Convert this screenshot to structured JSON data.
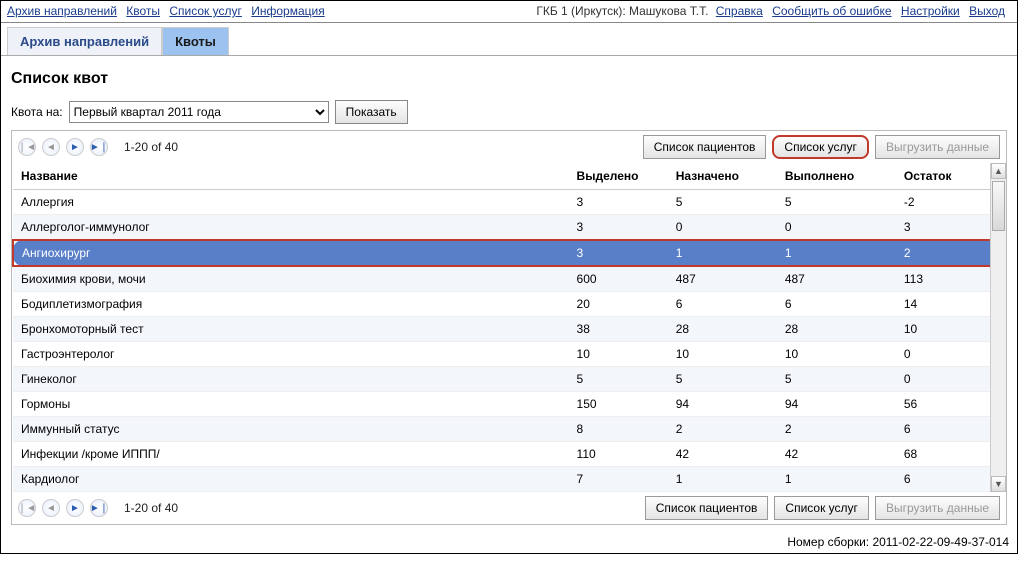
{
  "top_nav": {
    "left": [
      "Архив направлений",
      "Квоты",
      "Список услуг",
      "Информация"
    ],
    "right_user": "ГКБ 1 (Иркутск): Машукова Т.Т.",
    "right_links": [
      "Справка",
      "Сообщить об ошибке",
      "Настройки",
      "Выход"
    ]
  },
  "tabs": [
    {
      "label": "Архив направлений",
      "active": false
    },
    {
      "label": "Квоты",
      "active": true
    }
  ],
  "page_title": "Список квот",
  "filter": {
    "label": "Квота на:",
    "selected": "Первый квартал 2011 года",
    "show_btn": "Показать"
  },
  "pager": {
    "info": "1-20 of 40"
  },
  "action_buttons": {
    "patients": "Список пациентов",
    "services": "Список услуг",
    "export": "Выгрузить данные"
  },
  "columns": [
    "Название",
    "Выделено",
    "Назначено",
    "Выполнено",
    "Остаток"
  ],
  "rows": [
    {
      "name": "Аллергия",
      "allocated": "3",
      "assigned": "5",
      "done": "5",
      "rest": "-2"
    },
    {
      "name": "Аллерголог-иммунолог",
      "allocated": "3",
      "assigned": "0",
      "done": "0",
      "rest": "3"
    },
    {
      "name": "Ангиохирург",
      "allocated": "3",
      "assigned": "1",
      "done": "1",
      "rest": "2",
      "selected": true
    },
    {
      "name": "Биохимия крови, мочи",
      "allocated": "600",
      "assigned": "487",
      "done": "487",
      "rest": "113"
    },
    {
      "name": "Бодиплетизмография",
      "allocated": "20",
      "assigned": "6",
      "done": "6",
      "rest": "14"
    },
    {
      "name": "Бронхомоторный тест",
      "allocated": "38",
      "assigned": "28",
      "done": "28",
      "rest": "10"
    },
    {
      "name": "Гастроэнтеролог",
      "allocated": "10",
      "assigned": "10",
      "done": "10",
      "rest": "0"
    },
    {
      "name": "Гинеколог",
      "allocated": "5",
      "assigned": "5",
      "done": "5",
      "rest": "0"
    },
    {
      "name": "Гормоны",
      "allocated": "150",
      "assigned": "94",
      "done": "94",
      "rest": "56"
    },
    {
      "name": "Иммунный статус",
      "allocated": "8",
      "assigned": "2",
      "done": "2",
      "rest": "6"
    },
    {
      "name": "Инфекции /кроме ИППП/",
      "allocated": "110",
      "assigned": "42",
      "done": "42",
      "rest": "68"
    },
    {
      "name": "Кардиолог",
      "allocated": "7",
      "assigned": "1",
      "done": "1",
      "rest": "6"
    }
  ],
  "build_label": "Номер сборки:",
  "build_value": "2011-02-22-09-49-37-014"
}
